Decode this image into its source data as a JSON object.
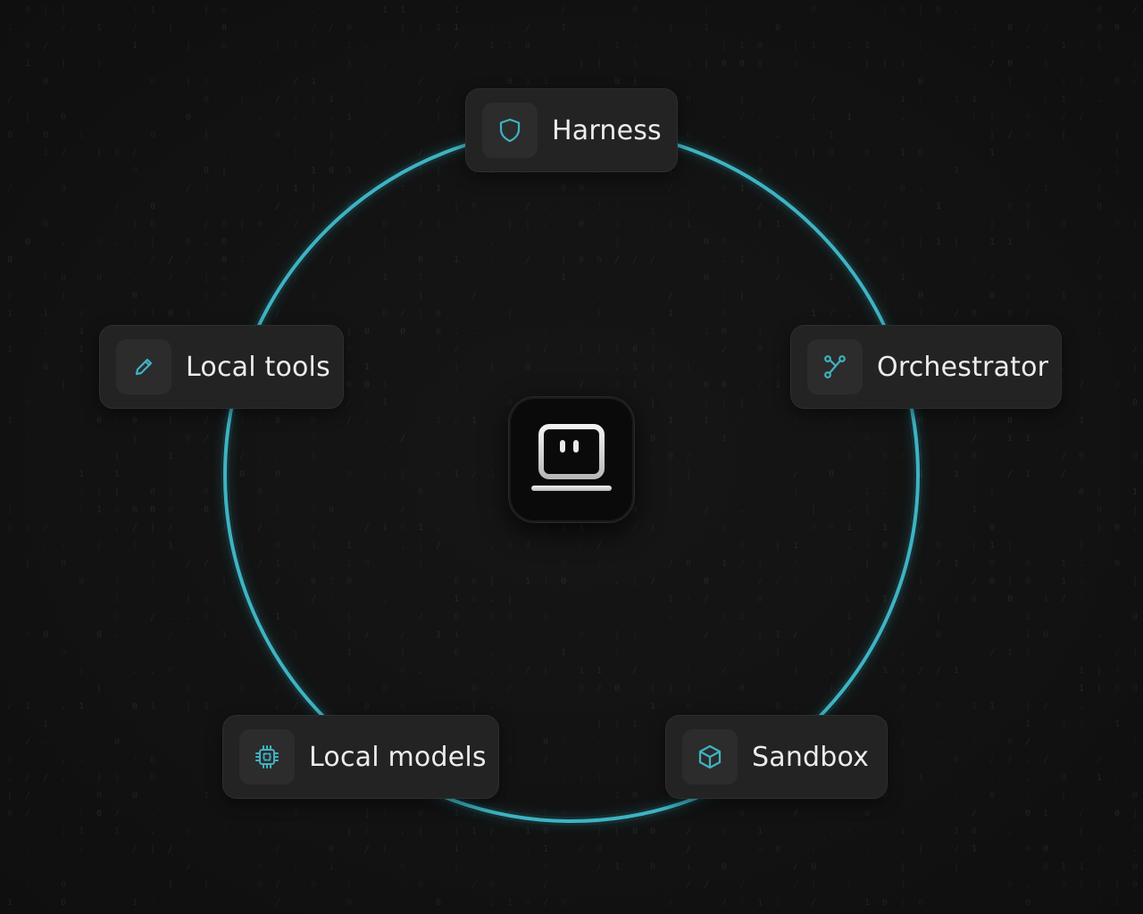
{
  "colors": {
    "accent": "#3fb3c2",
    "background": "#121212",
    "node_bg": "#232323",
    "text": "#ececec"
  },
  "hub": {
    "icon": "laptop-face-icon"
  },
  "nodes": {
    "harness": {
      "label": "Harness",
      "icon": "shield-icon"
    },
    "local_tools": {
      "label": "Local tools",
      "icon": "pencil-icon"
    },
    "orchestrator": {
      "label": "Orchestrator",
      "icon": "branch-icon"
    },
    "local_models": {
      "label": "Local models",
      "icon": "chip-icon"
    },
    "sandbox": {
      "label": "Sandbox",
      "icon": "cube-icon"
    }
  }
}
